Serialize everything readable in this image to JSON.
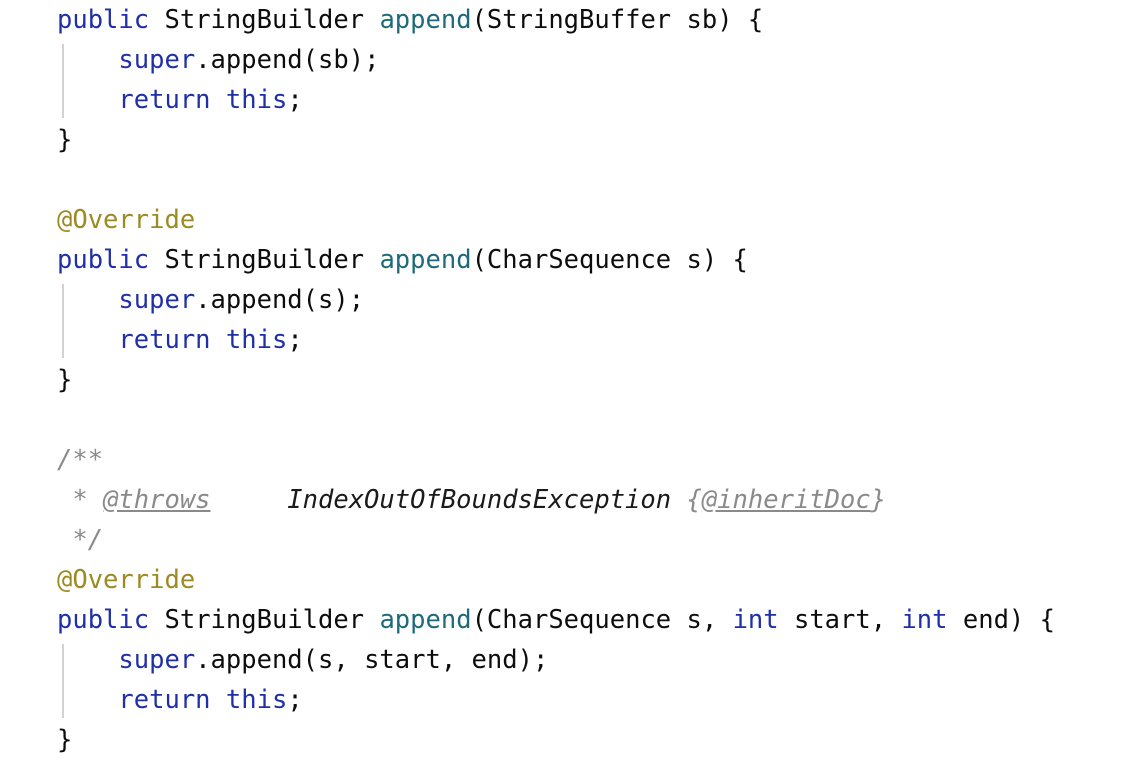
{
  "editor": {
    "language": "java",
    "background_color": "#ffffff",
    "default_text_color": "#0d0d0d",
    "indent_guide_color": "#d2d2d2",
    "font_size_px": 25.5,
    "line_height_px": 40,
    "palette": {
      "keyword": "#1f2fa8",
      "method_declaration": "#1d6b78",
      "annotation": "#9c8a23",
      "comment": "#8a8a8a",
      "javadoc_tag": "#8a8a8a",
      "javadoc_param_type": "#1a1a1a",
      "plain": "#0d0d0d"
    }
  },
  "code": {
    "lines": [
      {
        "id": "line-1",
        "indent_guide": false,
        "tokens": [
          {
            "t": "public",
            "c": "keyword"
          },
          {
            "t": " ",
            "c": "plain"
          },
          {
            "t": "StringBuilder",
            "c": "plain"
          },
          {
            "t": " ",
            "c": "plain"
          },
          {
            "t": "append",
            "c": "method"
          },
          {
            "t": "(StringBuffer sb) {",
            "c": "plain"
          }
        ]
      },
      {
        "id": "line-2",
        "indent_guide": true,
        "tokens": [
          {
            "t": "    ",
            "c": "plain"
          },
          {
            "t": "super",
            "c": "keyword"
          },
          {
            "t": ".append(sb);",
            "c": "plain"
          }
        ]
      },
      {
        "id": "line-3",
        "indent_guide": true,
        "tokens": [
          {
            "t": "    ",
            "c": "plain"
          },
          {
            "t": "return",
            "c": "keyword"
          },
          {
            "t": " ",
            "c": "plain"
          },
          {
            "t": "this",
            "c": "keyword"
          },
          {
            "t": ";",
            "c": "plain"
          }
        ]
      },
      {
        "id": "line-4",
        "indent_guide": false,
        "tokens": [
          {
            "t": "}",
            "c": "plain"
          }
        ]
      },
      {
        "id": "line-5",
        "indent_guide": false,
        "tokens": []
      },
      {
        "id": "line-6",
        "indent_guide": false,
        "tokens": [
          {
            "t": "@Override",
            "c": "annot"
          }
        ]
      },
      {
        "id": "line-7",
        "indent_guide": false,
        "tokens": [
          {
            "t": "public",
            "c": "keyword"
          },
          {
            "t": " ",
            "c": "plain"
          },
          {
            "t": "StringBuilder",
            "c": "plain"
          },
          {
            "t": " ",
            "c": "plain"
          },
          {
            "t": "append",
            "c": "method"
          },
          {
            "t": "(CharSequence s) {",
            "c": "plain"
          }
        ]
      },
      {
        "id": "line-8",
        "indent_guide": true,
        "tokens": [
          {
            "t": "    ",
            "c": "plain"
          },
          {
            "t": "super",
            "c": "keyword"
          },
          {
            "t": ".append(s);",
            "c": "plain"
          }
        ]
      },
      {
        "id": "line-9",
        "indent_guide": true,
        "tokens": [
          {
            "t": "    ",
            "c": "plain"
          },
          {
            "t": "return",
            "c": "keyword"
          },
          {
            "t": " ",
            "c": "plain"
          },
          {
            "t": "this",
            "c": "keyword"
          },
          {
            "t": ";",
            "c": "plain"
          }
        ]
      },
      {
        "id": "line-10",
        "indent_guide": false,
        "tokens": [
          {
            "t": "}",
            "c": "plain"
          }
        ]
      },
      {
        "id": "line-11",
        "indent_guide": false,
        "tokens": []
      },
      {
        "id": "line-12",
        "indent_guide": false,
        "tokens": [
          {
            "t": "/**",
            "c": "comment"
          }
        ]
      },
      {
        "id": "line-13",
        "indent_guide": false,
        "tokens": [
          {
            "t": " * ",
            "c": "comment"
          },
          {
            "t": "@throws",
            "c": "doctag"
          },
          {
            "t": "     ",
            "c": "comment"
          },
          {
            "t": "IndexOutOfBoundsException",
            "c": "docparam"
          },
          {
            "t": " ",
            "c": "comment"
          },
          {
            "t": "{",
            "c": "docbrace"
          },
          {
            "t": "@inheritDoc",
            "c": "doctag"
          },
          {
            "t": "}",
            "c": "docbrace"
          }
        ]
      },
      {
        "id": "line-14",
        "indent_guide": false,
        "tokens": [
          {
            "t": " */",
            "c": "comment"
          }
        ]
      },
      {
        "id": "line-15",
        "indent_guide": false,
        "tokens": [
          {
            "t": "@Override",
            "c": "annot"
          }
        ]
      },
      {
        "id": "line-16",
        "indent_guide": false,
        "tokens": [
          {
            "t": "public",
            "c": "keyword"
          },
          {
            "t": " ",
            "c": "plain"
          },
          {
            "t": "StringBuilder",
            "c": "plain"
          },
          {
            "t": " ",
            "c": "plain"
          },
          {
            "t": "append",
            "c": "method"
          },
          {
            "t": "(CharSequence s, ",
            "c": "plain"
          },
          {
            "t": "int",
            "c": "keyword"
          },
          {
            "t": " start, ",
            "c": "plain"
          },
          {
            "t": "int",
            "c": "keyword"
          },
          {
            "t": " end) {",
            "c": "plain"
          }
        ]
      },
      {
        "id": "line-17",
        "indent_guide": true,
        "tokens": [
          {
            "t": "    ",
            "c": "plain"
          },
          {
            "t": "super",
            "c": "keyword"
          },
          {
            "t": ".append(s, start, end);",
            "c": "plain"
          }
        ]
      },
      {
        "id": "line-18",
        "indent_guide": true,
        "tokens": [
          {
            "t": "    ",
            "c": "plain"
          },
          {
            "t": "return",
            "c": "keyword"
          },
          {
            "t": " ",
            "c": "plain"
          },
          {
            "t": "this",
            "c": "keyword"
          },
          {
            "t": ";",
            "c": "plain"
          }
        ]
      },
      {
        "id": "line-19",
        "indent_guide": false,
        "tokens": [
          {
            "t": "}",
            "c": "plain"
          }
        ]
      }
    ]
  }
}
